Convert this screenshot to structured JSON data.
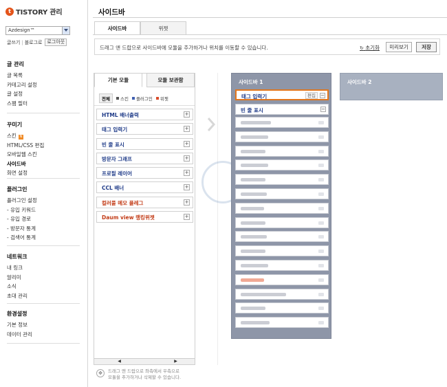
{
  "brand": {
    "logo_mark": "t",
    "logo_text": "TISTORY 관리"
  },
  "blog_select": {
    "value": "Azdesign™"
  },
  "quick_links": {
    "posting": "글쓰기",
    "blog": "블로그로",
    "logout": "로그아웃"
  },
  "nav": [
    {
      "title": "글 관리",
      "items": [
        "글 목록",
        "카테고리 설정",
        "글 설정",
        "스팸 필터"
      ]
    },
    {
      "title": "꾸미기",
      "items": [
        "스킨",
        "HTML/CSS 편집",
        "모바일웹 스킨",
        "사이드바",
        "화면 설정"
      ],
      "active": "사이드바",
      "badge_item": "스킨",
      "badge": "N"
    },
    {
      "title": "플러그인",
      "items": [
        "플러그인 설정",
        "- 유입 키워드",
        "- 유입 경로",
        "- 방문자 통계",
        "- 검색어 통계"
      ]
    },
    {
      "title": "네트워크",
      "items": [
        "내 링크",
        "알리미",
        "소식",
        "초대 관리"
      ]
    },
    {
      "title": "환경설정",
      "items": [
        "기본 정보",
        "데이터 관리"
      ]
    }
  ],
  "page": {
    "title": "사이드바"
  },
  "tabs": [
    {
      "label": "사이드바",
      "active": true
    },
    {
      "label": "위젯",
      "active": false
    }
  ],
  "info_bar": {
    "text": "드래그 앤 드랍으로 사이드바에 모듈을 추가하거나 위치를 이동할 수 있습니다.",
    "reset": "초기화",
    "preview": "미리보기",
    "save": "저장"
  },
  "module_panel": {
    "tabs": [
      "기본 모듈",
      "모듈 보관함"
    ],
    "filters": [
      {
        "label": "전체",
        "active": true,
        "color": ""
      },
      {
        "label": "스킨",
        "active": false,
        "color": "#555555"
      },
      {
        "label": "플러그인",
        "active": false,
        "color": "#4060b0"
      },
      {
        "label": "위젯",
        "active": false,
        "color": "#d94b2a"
      }
    ],
    "items": [
      {
        "label": "HTML 배너출력",
        "red": false
      },
      {
        "label": "태그 입력기",
        "red": false
      },
      {
        "label": "빈 줄 표시",
        "red": false
      },
      {
        "label": "방문자 그래프",
        "red": false
      },
      {
        "label": "프로필 레이어",
        "red": false
      },
      {
        "label": "CCL 배너",
        "red": false
      },
      {
        "label": "컬러풀 메모 플레그",
        "red": true
      },
      {
        "label": "Daum view 랭킹위젯",
        "red": true
      }
    ],
    "scroll_left": "◀",
    "scroll_right": "▶"
  },
  "footnote": "드래그 앤 드랍으로 좌측에서 우측으로\n모듈을 추가하거나 삭제할 수 있습니다.",
  "sidebar1": {
    "title": "사이드바 1",
    "items": [
      {
        "label": "태그 입력기",
        "edit": "편집",
        "highlight": true,
        "blurred": false
      },
      {
        "label": "빈 줄 표시",
        "edit": "",
        "highlight": false,
        "blurred": false
      },
      {
        "label": "",
        "blurred": true
      },
      {
        "label": "",
        "blurred": true
      },
      {
        "label": "",
        "blurred": true
      },
      {
        "label": "",
        "blurred": true
      },
      {
        "label": "",
        "blurred": true
      },
      {
        "label": "",
        "blurred": true
      },
      {
        "label": "",
        "blurred": true
      },
      {
        "label": "",
        "blurred": true
      },
      {
        "label": "",
        "blurred": true
      },
      {
        "label": "",
        "blurred": true
      },
      {
        "label": "",
        "blurred": true
      },
      {
        "label": "",
        "blurred": true,
        "red": true
      },
      {
        "label": "",
        "blurred": true
      },
      {
        "label": "",
        "blurred": true
      },
      {
        "label": "",
        "blurred": true
      }
    ],
    "minus": "−"
  },
  "sidebar2": {
    "title": "사이드바 2"
  },
  "colors": {
    "accent": "#e2761c",
    "sidebar_bg": "#8e96a8",
    "link": "#1f3b88"
  }
}
